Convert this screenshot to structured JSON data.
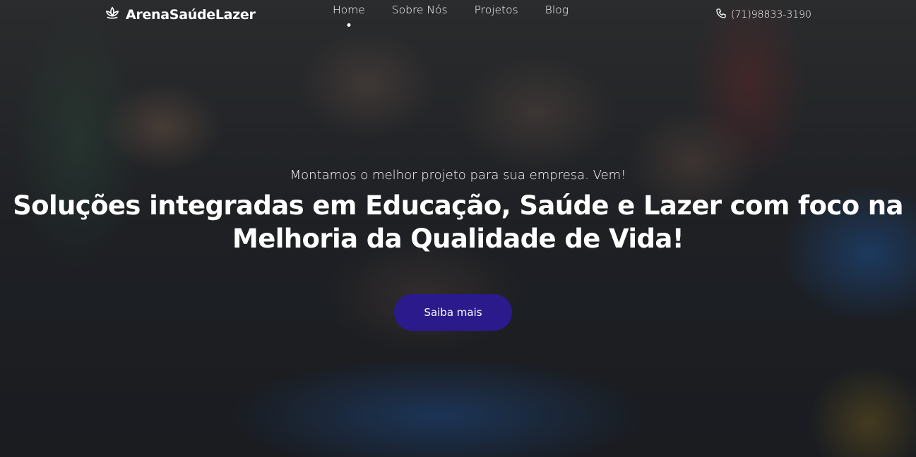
{
  "brand": {
    "name": "ArenaSaúdeLazer",
    "icon": "lotus-icon"
  },
  "nav": {
    "items": [
      {
        "label": "Home",
        "active": true
      },
      {
        "label": "Sobre Nós",
        "active": false
      },
      {
        "label": "Projetos",
        "active": false
      },
      {
        "label": "Blog",
        "active": false
      }
    ]
  },
  "contact": {
    "phone": "(71)98833-3190",
    "icon": "phone-icon"
  },
  "hero": {
    "tagline": "Montamos o melhor projeto para sua empresa. Vem!",
    "headline_line1": "Soluções integradas em Educação, Saúde e Lazer com foco na",
    "headline_line2": "Melhoria da Qualidade de Vida!",
    "cta_label": "Saiba mais"
  },
  "colors": {
    "cta_background": "#2a1a8c",
    "text": "#ffffff"
  }
}
